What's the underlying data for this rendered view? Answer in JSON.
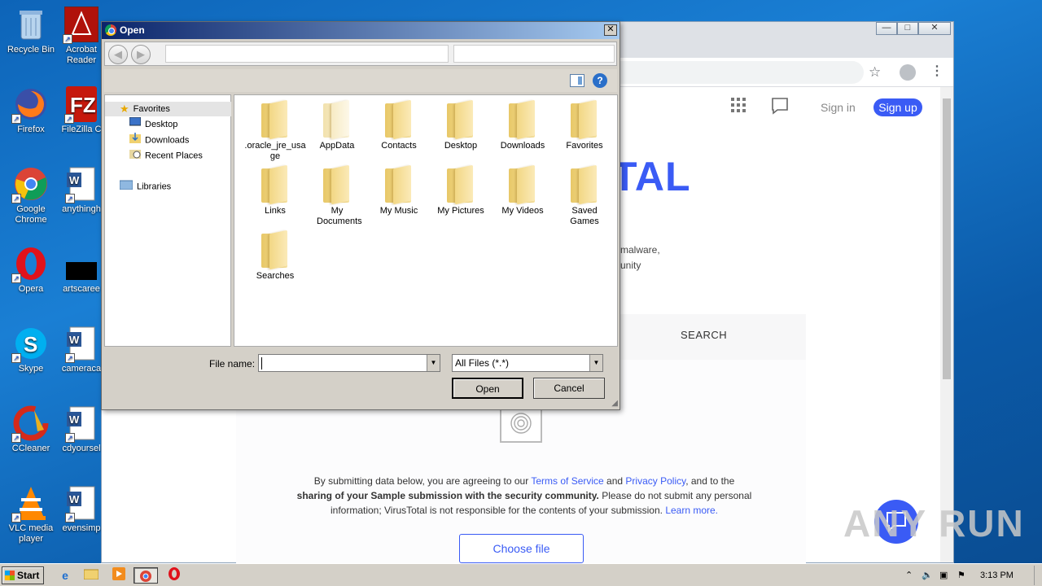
{
  "desktop": {
    "icons": [
      {
        "label": "Recycle Bin"
      },
      {
        "label": "Acrobat Reader"
      },
      {
        "label": "Firefox"
      },
      {
        "label": "FileZilla C"
      },
      {
        "label": "Google Chrome"
      },
      {
        "label": "anythingh"
      },
      {
        "label": "Opera"
      },
      {
        "label": "artscaree"
      },
      {
        "label": "Skype"
      },
      {
        "label": "cameraca"
      },
      {
        "label": "CCleaner"
      },
      {
        "label": "cdyoursel"
      },
      {
        "label": "VLC media player"
      },
      {
        "label": "evensimp"
      }
    ]
  },
  "browser": {
    "window_controls": {
      "minimize": "—",
      "maximize": "□",
      "close": "✕"
    },
    "header": {
      "signin": "Sign in",
      "signup": "Sign up"
    },
    "logo_partial": "TAL",
    "desc_line1": "malware,",
    "desc_line2": "unity",
    "search_tab": "SEARCH",
    "terms": {
      "p1": "By submitting data below, you are agreeing to our ",
      "tos": "Terms of Service",
      "and": " and ",
      "privacy": "Privacy Policy",
      "p2": ", and to the",
      "bold": "sharing of your Sample submission with the security community.",
      "p3": " Please do not submit any personal",
      "p4": "information; VirusTotal is not responsible for the contents of your submission. ",
      "learn": "Learn more."
    },
    "choose_file": "Choose file",
    "watermark": "ANY RUN"
  },
  "dialog": {
    "title": "Open",
    "close": "✕",
    "nav": {
      "back": "◀",
      "forward": "▶"
    },
    "help": "?",
    "navpane": {
      "favorites": "Favorites",
      "desktop": "Desktop",
      "downloads": "Downloads",
      "recent": "Recent Places",
      "libraries": "Libraries"
    },
    "folders": [
      {
        "name": ".oracle_jre_usage"
      },
      {
        "name": "AppData"
      },
      {
        "name": "Contacts"
      },
      {
        "name": "Desktop"
      },
      {
        "name": "Downloads"
      },
      {
        "name": "Favorites"
      },
      {
        "name": "Links"
      },
      {
        "name": "My Documents"
      },
      {
        "name": "My Music"
      },
      {
        "name": "My Pictures"
      },
      {
        "name": "My Videos"
      },
      {
        "name": "Saved Games"
      },
      {
        "name": "Searches"
      }
    ],
    "filename_label": "File name:",
    "filename_value": "",
    "filetype": "All Files (*.*)",
    "open": "Open",
    "cancel": "Cancel"
  },
  "taskbar": {
    "start": "Start",
    "time": "3:13 PM"
  },
  "colors": {
    "accent": "#3a5bf5",
    "dialog_bg": "#d4d0c8",
    "desktop": "#1a7fd4"
  }
}
